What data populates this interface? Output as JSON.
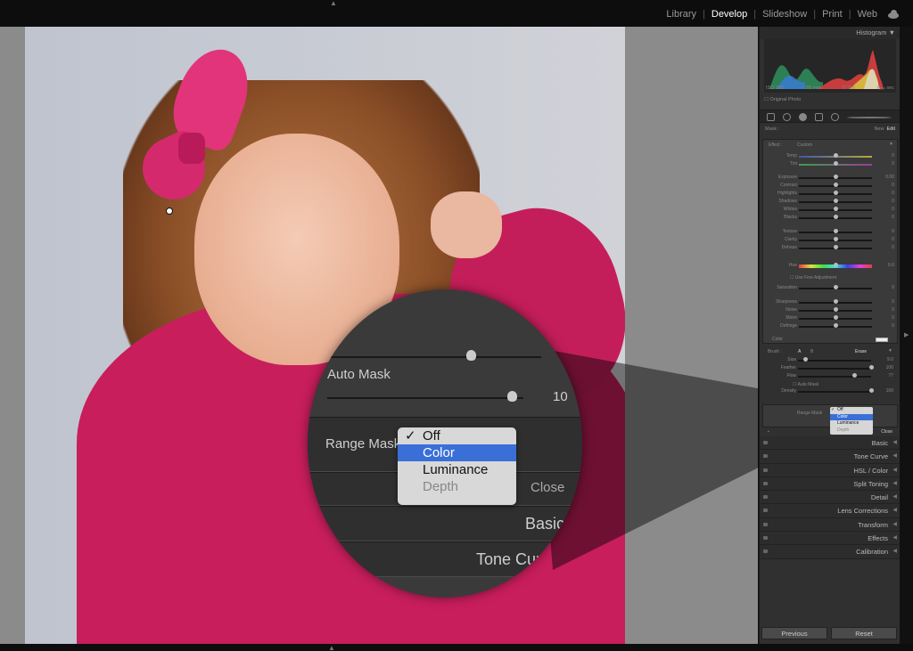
{
  "modules": {
    "items": [
      "Library",
      "Develop",
      "Slideshow",
      "Print",
      "Web"
    ],
    "active": "Develop"
  },
  "histogram": {
    "title": "Histogram",
    "iso": "ISO 100",
    "focal": "85 mm",
    "aperture": "f / 1.6",
    "shutter": "¹⁄₂₅₀ sec",
    "original_label": "Original Photo"
  },
  "mask": {
    "label": "Mask :",
    "new": "New",
    "edit": "Edit"
  },
  "effect": {
    "label": "Effect :",
    "preset": "Custom",
    "rows": [
      {
        "label": "Temp",
        "value": "0",
        "level": 0.5
      },
      {
        "label": "Tint",
        "value": "0",
        "level": 0.5
      },
      {
        "label": "Exposure",
        "value": "0.00",
        "level": 0.5
      },
      {
        "label": "Contrast",
        "value": "0",
        "level": 0.5
      },
      {
        "label": "Highlights",
        "value": "0",
        "level": 0.5
      },
      {
        "label": "Shadows",
        "value": "0",
        "level": 0.5
      },
      {
        "label": "Whites",
        "value": "0",
        "level": 0.5
      },
      {
        "label": "Blacks",
        "value": "0",
        "level": 0.5
      },
      {
        "label": "Texture",
        "value": "0",
        "level": 0.5
      },
      {
        "label": "Clarity",
        "value": "0",
        "level": 0.5
      },
      {
        "label": "Dehaze",
        "value": "0",
        "level": 0.5
      },
      {
        "label": "Hue",
        "value": "0.0",
        "level": 0.5
      },
      {
        "label": "Saturation",
        "value": "0",
        "level": 0.5
      },
      {
        "label": "Sharpness",
        "value": "0",
        "level": 0.5
      },
      {
        "label": "Noise",
        "value": "0",
        "level": 0.5
      },
      {
        "label": "Moiré",
        "value": "0",
        "level": 0.5
      },
      {
        "label": "Defringe",
        "value": "0",
        "level": 0.5
      }
    ],
    "fine_adjust": "Use Fine Adjustment",
    "color_label": "Color"
  },
  "brush": {
    "label": "Brush :",
    "a": "A",
    "b": "B",
    "erase": "Erase",
    "rows": [
      {
        "label": "Size",
        "value": "9.0",
        "level": 0.1
      },
      {
        "label": "Feather",
        "value": "100",
        "level": 1.0
      },
      {
        "label": "Flow",
        "value": "77",
        "level": 0.77
      },
      {
        "label": "Density",
        "value": "100",
        "level": 1.0
      }
    ],
    "auto_mask": "Auto Mask"
  },
  "range_mask": {
    "label": "Range Mask",
    "options": [
      "Off",
      "Color",
      "Luminance",
      "Depth"
    ],
    "checked": "Off",
    "highlighted": "Color",
    "disabled": "Depth",
    "close": "Close"
  },
  "magnifier": {
    "auto_mask": "Auto Mask",
    "value_partial": "10",
    "range_label": "Range Mask",
    "close": "Close",
    "basic": "Basic",
    "tone": "Tone Cur"
  },
  "sections": [
    "Basic",
    "Tone Curve",
    "HSL / Color",
    "Split Toning",
    "Detail",
    "Lens Corrections",
    "Transform",
    "Effects",
    "Calibration"
  ],
  "buttons": {
    "previous": "Previous",
    "reset": "Reset"
  }
}
